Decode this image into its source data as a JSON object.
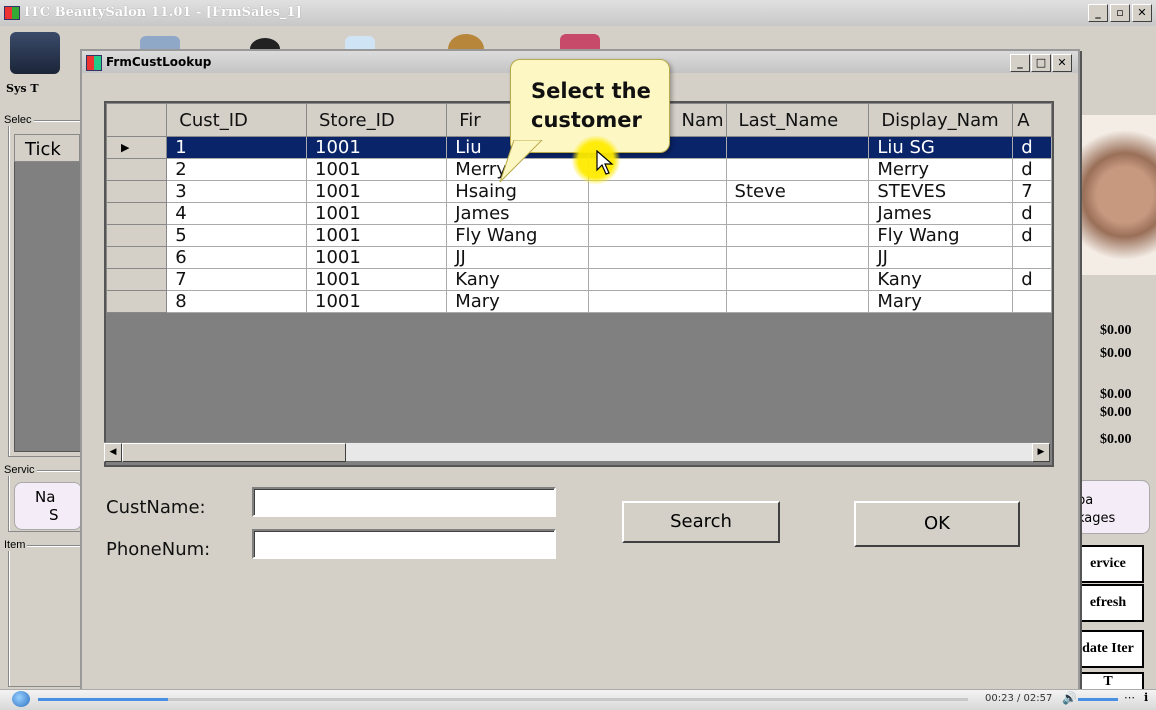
{
  "main_window": {
    "title": "ITC BeautySalon 11.01 - [FrmSales_1]",
    "sys_tools_label": "Sys T",
    "select_group_label": "Selec",
    "tick_label": "Tick",
    "service_group_label": "Servic",
    "item_group_label": "Item",
    "na_label": "Na",
    "s_label": "S",
    "spa_label": "pa",
    "packages_label": "kages",
    "amounts": [
      "$0.00",
      "$0.00",
      "$0.00",
      "$0.00",
      "$0.00"
    ],
    "buttons": [
      "ervice",
      "efresh",
      "date Iter",
      "T"
    ]
  },
  "dialog": {
    "title": "FrmCustLookup",
    "columns": [
      "Cust_ID",
      "Store_ID",
      "Fir",
      "Nam",
      "Last_Name",
      "Display_Nam",
      "A"
    ],
    "rows": [
      [
        "1",
        "1001",
        "Liu",
        "",
        "",
        "Liu SG",
        "d"
      ],
      [
        "2",
        "1001",
        "Merry",
        "",
        "",
        "Merry",
        "d"
      ],
      [
        "3",
        "1001",
        "Hsaing",
        "",
        "Steve",
        "STEVES",
        "7"
      ],
      [
        "4",
        "1001",
        "James",
        "",
        "",
        "James",
        "d"
      ],
      [
        "5",
        "1001",
        "Fly Wang",
        "",
        "",
        "Fly Wang",
        "d"
      ],
      [
        "6",
        "1001",
        "JJ",
        "",
        "",
        "JJ",
        ""
      ],
      [
        "7",
        "1001",
        "Kany",
        "",
        "",
        "Kany",
        "d"
      ],
      [
        "8",
        "1001",
        "Mary",
        "",
        "",
        "Mary",
        ""
      ]
    ],
    "selected_row_index": 0,
    "current_row_marker": "▶",
    "custname_label": "CustName:",
    "custname_value": "",
    "phonenum_label": "PhoneNum:",
    "phonenum_value": "",
    "search_button": "Search",
    "ok_button": "OK"
  },
  "callout": {
    "line1": "Select the",
    "line2": "customer"
  },
  "player": {
    "time": "00:23 / 02:57"
  },
  "colors": {
    "selection": "#0a246a",
    "callout_bg": "#fdf7c3",
    "cursor_highlight": "#ffeb00"
  }
}
